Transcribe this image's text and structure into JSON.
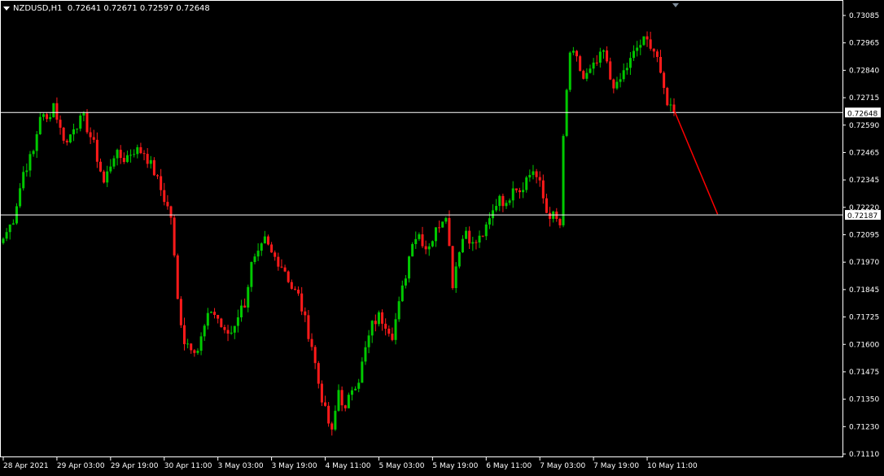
{
  "header": {
    "symbol": "NZDUSD,H1",
    "ohlc": "0.72641 0.72671 0.72597 0.72648"
  },
  "colors": {
    "background": "#000000",
    "bull": "#00c800",
    "bear": "#ff1a1a",
    "axis_text": "#ffffff",
    "hline": "#ffffff",
    "arrow": "#ff0000",
    "price_marker": "#a0a0a0"
  },
  "chart_data": {
    "type": "candlestick",
    "ylim": [
      0.7108,
      0.7313
    ],
    "y_ticks": [
      "0.73085",
      "0.72965",
      "0.72840",
      "0.72715",
      "0.72590",
      "0.72465",
      "0.72345",
      "0.72220",
      "0.72095",
      "0.71970",
      "0.71845",
      "0.71725",
      "0.71600",
      "0.71475",
      "0.71350",
      "0.71230",
      "0.71110"
    ],
    "x_ticks": [
      {
        "label": "28 Apr 2021",
        "index": 0
      },
      {
        "label": "29 Apr 03:00",
        "index": 16
      },
      {
        "label": "29 Apr 19:00",
        "index": 32
      },
      {
        "label": "30 Apr 11:00",
        "index": 48
      },
      {
        "label": "3 May 03:00",
        "index": 64
      },
      {
        "label": "3 May 19:00",
        "index": 80
      },
      {
        "label": "4 May 11:00",
        "index": 96
      },
      {
        "label": "5 May 03:00",
        "index": 112
      },
      {
        "label": "5 May 19:00",
        "index": 128
      },
      {
        "label": "6 May 11:00",
        "index": 144
      },
      {
        "label": "7 May 03:00",
        "index": 160
      },
      {
        "label": "7 May 19:00",
        "index": 176
      },
      {
        "label": "10 May 11:00",
        "index": 192
      }
    ],
    "close_path": [
      [
        0,
        0.7208
      ],
      [
        3,
        0.7217
      ],
      [
        6,
        0.7238
      ],
      [
        9,
        0.7247
      ],
      [
        11,
        0.7264
      ],
      [
        13,
        0.7261
      ],
      [
        15,
        0.7269
      ],
      [
        17,
        0.7257
      ],
      [
        19,
        0.7251
      ],
      [
        21,
        0.7259
      ],
      [
        24,
        0.7262
      ],
      [
        27,
        0.725
      ],
      [
        30,
        0.7233
      ],
      [
        33,
        0.7246
      ],
      [
        36,
        0.7244
      ],
      [
        39,
        0.7248
      ],
      [
        42,
        0.7247
      ],
      [
        45,
        0.7238
      ],
      [
        48,
        0.7226
      ],
      [
        50,
        0.7218
      ],
      [
        52,
        0.718
      ],
      [
        54,
        0.7162
      ],
      [
        56,
        0.716
      ],
      [
        58,
        0.7158
      ],
      [
        60,
        0.7168
      ],
      [
        62,
        0.7176
      ],
      [
        64,
        0.7172
      ],
      [
        66,
        0.7165
      ],
      [
        68,
        0.7166
      ],
      [
        70,
        0.7174
      ],
      [
        72,
        0.7179
      ],
      [
        74,
        0.7196
      ],
      [
        76,
        0.72
      ],
      [
        78,
        0.7207
      ],
      [
        80,
        0.7201
      ],
      [
        82,
        0.7198
      ],
      [
        84,
        0.7194
      ],
      [
        86,
        0.7186
      ],
      [
        88,
        0.7182
      ],
      [
        90,
        0.7171
      ],
      [
        92,
        0.716
      ],
      [
        94,
        0.7143
      ],
      [
        96,
        0.713
      ],
      [
        98,
        0.712
      ],
      [
        100,
        0.714
      ],
      [
        102,
        0.713
      ],
      [
        104,
        0.7141
      ],
      [
        106,
        0.7145
      ],
      [
        108,
        0.7158
      ],
      [
        110,
        0.7169
      ],
      [
        112,
        0.7173
      ],
      [
        114,
        0.717
      ],
      [
        116,
        0.7165
      ],
      [
        118,
        0.7178
      ],
      [
        120,
        0.7192
      ],
      [
        122,
        0.7208
      ],
      [
        124,
        0.721
      ],
      [
        126,
        0.7204
      ],
      [
        128,
        0.7208
      ],
      [
        130,
        0.7215
      ],
      [
        132,
        0.722
      ],
      [
        134,
        0.7188
      ],
      [
        136,
        0.7204
      ],
      [
        138,
        0.7212
      ],
      [
        140,
        0.7205
      ],
      [
        142,
        0.7208
      ],
      [
        144,
        0.7212
      ],
      [
        146,
        0.722
      ],
      [
        148,
        0.7228
      ],
      [
        150,
        0.7222
      ],
      [
        152,
        0.7233
      ],
      [
        154,
        0.723
      ],
      [
        156,
        0.7235
      ],
      [
        158,
        0.7239
      ],
      [
        160,
        0.7232
      ],
      [
        162,
        0.722
      ],
      [
        164,
        0.7218
      ],
      [
        166,
        0.7214
      ],
      [
        167,
        0.7252
      ],
      [
        168,
        0.7274
      ],
      [
        169,
        0.7292
      ],
      [
        171,
        0.7288
      ],
      [
        173,
        0.728
      ],
      [
        175,
        0.7283
      ],
      [
        177,
        0.7287
      ],
      [
        179,
        0.7292
      ],
      [
        181,
        0.728
      ],
      [
        183,
        0.7276
      ],
      [
        185,
        0.7283
      ],
      [
        187,
        0.7288
      ],
      [
        189,
        0.7294
      ],
      [
        191,
        0.7297
      ],
      [
        193,
        0.7296
      ],
      [
        195,
        0.729
      ],
      [
        196,
        0.728
      ],
      [
        198,
        0.727
      ],
      [
        200,
        0.72648
      ]
    ],
    "hlines": [
      {
        "label": "0.72648",
        "value": 0.72648
      },
      {
        "label": "0.72187",
        "value": 0.72187
      }
    ],
    "arrow": {
      "from": {
        "index": 200,
        "value": 0.7266
      },
      "to": {
        "index": 213,
        "value": 0.7219
      }
    }
  }
}
